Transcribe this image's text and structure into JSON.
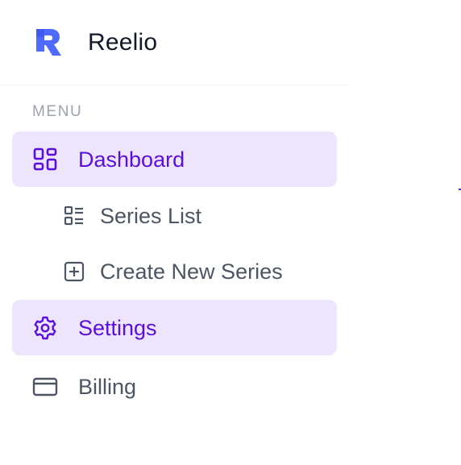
{
  "brand": {
    "name": "Reelio",
    "logo_icon": "reelio-logo-icon",
    "color": "#4f6bff"
  },
  "menu": {
    "section_label": "MENU",
    "items": [
      {
        "label": "Dashboard",
        "icon": "grid-icon",
        "active": true
      },
      {
        "label": "Series List",
        "icon": "list-icon",
        "active": false,
        "sub": true
      },
      {
        "label": "Create New Series",
        "icon": "plus-square-icon",
        "active": false,
        "sub": true
      },
      {
        "label": "Settings",
        "icon": "gear-icon",
        "active": true
      },
      {
        "label": "Billing",
        "icon": "credit-card-icon",
        "active": false
      }
    ]
  },
  "colors": {
    "active_bg": "#ede5fd",
    "active_text": "#5b0fdb",
    "muted_text": "#4b5563",
    "section": "#9ca3af"
  }
}
